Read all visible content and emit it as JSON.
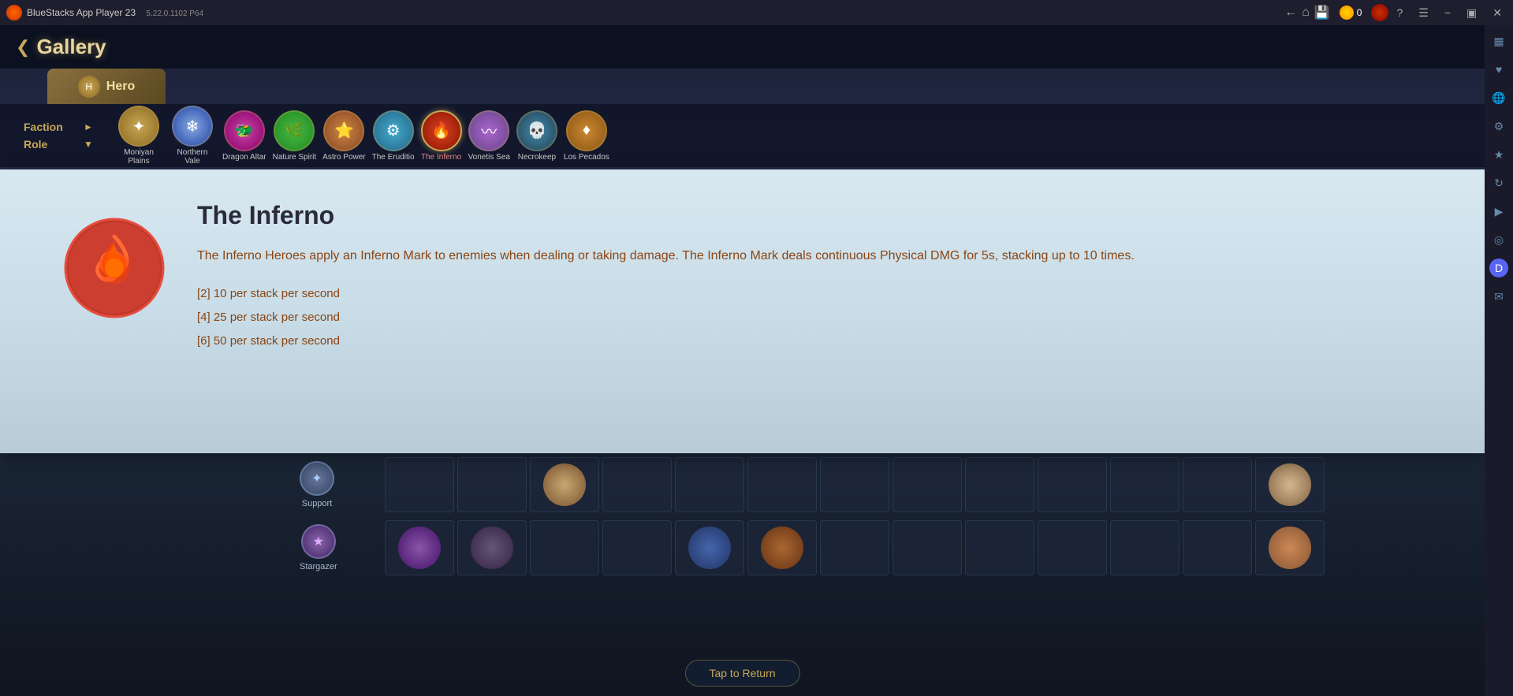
{
  "titlebar": {
    "app_name": "BlueStacks App Player 23",
    "version": "5.22.0.1102  P64",
    "coin_count": "0"
  },
  "gallery": {
    "back_label": "Gallery",
    "hero_tab_label": "Hero"
  },
  "filter": {
    "faction_label": "Faction",
    "role_label": "Role",
    "factions": [
      {
        "id": "moniyan",
        "label": "Moniyan Plains",
        "color_class": "fi-moniyan",
        "icon": "✦"
      },
      {
        "id": "northern",
        "label": "Northern Vale",
        "color_class": "fi-northern",
        "icon": "❄"
      },
      {
        "id": "dragon",
        "label": "Dragon Altar",
        "color_class": "fi-dragon",
        "icon": "🐉"
      },
      {
        "id": "nature",
        "label": "Nature Spirit",
        "color_class": "fi-nature",
        "icon": "🌿"
      },
      {
        "id": "astro",
        "label": "Astro Power",
        "color_class": "fi-astro",
        "icon": "⭐"
      },
      {
        "id": "eruditio",
        "label": "The Eruditio",
        "color_class": "fi-eruditio",
        "icon": "⚙"
      },
      {
        "id": "inferno",
        "label": "The Inferno",
        "color_class": "fi-inferno",
        "icon": "🔥",
        "selected": true
      },
      {
        "id": "vonetis",
        "label": "Vonetis Sea",
        "color_class": "fi-vonetis",
        "icon": "〰"
      },
      {
        "id": "necro",
        "label": "Necrokeep",
        "color_class": "fi-necro",
        "icon": "💀"
      },
      {
        "id": "lospeca",
        "label": "Los Pecados",
        "color_class": "fi-lospeca",
        "icon": "♦"
      }
    ]
  },
  "inferno_popup": {
    "title": "The Inferno",
    "description": "The Inferno Heroes apply an Inferno Mark to enemies when dealing or taking damage. The Inferno Mark deals continuous Physical DMG for 5s, stacking up to 10 times.",
    "stat1": "[2] 10 per stack per second",
    "stat2": "[4] 25 per stack per second",
    "stat3": "[6] 50 per stack per second"
  },
  "bottom": {
    "support_label": "Support",
    "stargazer_label": "Stargazer",
    "tap_return": "Tap to Return"
  },
  "sidebar": {
    "icons": [
      "⊞",
      "♡",
      "🌐",
      "⚙",
      "★",
      "↻",
      "▶",
      "◎",
      "✉"
    ]
  }
}
